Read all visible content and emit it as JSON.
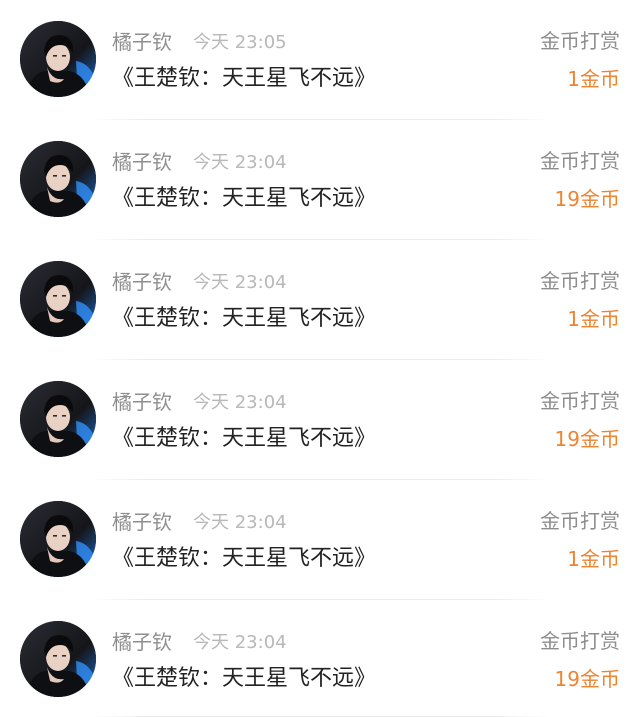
{
  "accent_color": "#f0832e",
  "avatar_icon": "user-photo-avatar",
  "entries": [
    {
      "user": "橘子钦",
      "time": "今天 23:05",
      "work": "《王楚钦：天王星飞不远》",
      "type": "金币打赏",
      "amount": "1金币"
    },
    {
      "user": "橘子钦",
      "time": "今天 23:04",
      "work": "《王楚钦：天王星飞不远》",
      "type": "金币打赏",
      "amount": "19金币"
    },
    {
      "user": "橘子钦",
      "time": "今天 23:04",
      "work": "《王楚钦：天王星飞不远》",
      "type": "金币打赏",
      "amount": "1金币"
    },
    {
      "user": "橘子钦",
      "time": "今天 23:04",
      "work": "《王楚钦：天王星飞不远》",
      "type": "金币打赏",
      "amount": "19金币"
    },
    {
      "user": "橘子钦",
      "time": "今天 23:04",
      "work": "《王楚钦：天王星飞不远》",
      "type": "金币打赏",
      "amount": "1金币"
    },
    {
      "user": "橘子钦",
      "time": "今天 23:04",
      "work": "《王楚钦：天王星飞不远》",
      "type": "金币打赏",
      "amount": "19金币"
    }
  ]
}
